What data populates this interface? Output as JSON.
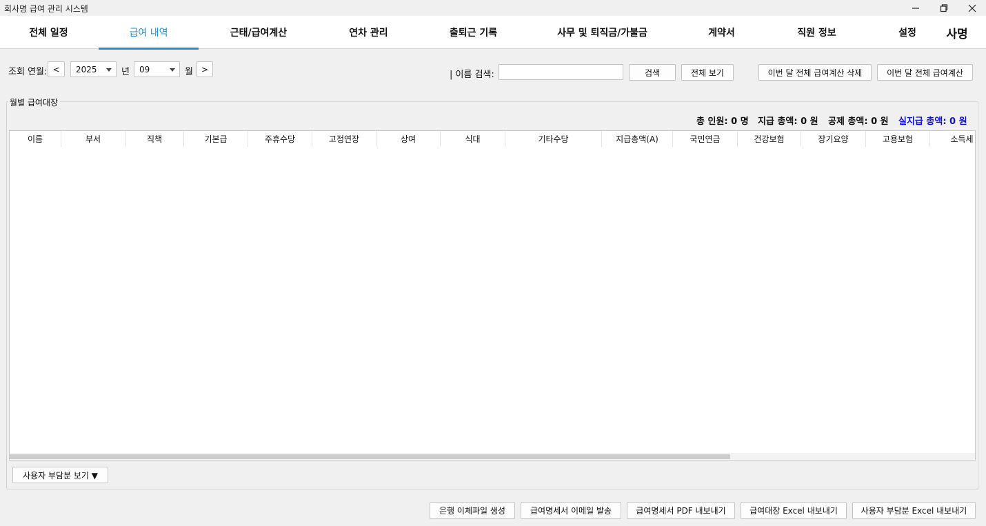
{
  "window": {
    "title": "회사명 급여 관리 시스템",
    "controls": [
      "minimize-icon",
      "restore-icon",
      "close-icon"
    ]
  },
  "tabs": [
    {
      "label": "전체 일정",
      "active": false
    },
    {
      "label": "급여 내역",
      "active": true
    },
    {
      "label": "근태/급여계산",
      "active": false
    },
    {
      "label": "연차 관리",
      "active": false
    },
    {
      "label": "출퇴근 기록",
      "active": false
    },
    {
      "label": "사무 및 퇴직금/가불금",
      "active": false
    },
    {
      "label": "계약서",
      "active": false
    },
    {
      "label": "직원 정보",
      "active": false
    },
    {
      "label": "설정",
      "active": false
    }
  ],
  "company_name": "사명",
  "toolbar": {
    "period_label": "조회 연월:",
    "prev_label": "<",
    "year_value": "2025",
    "year_unit": "년",
    "month_value": "09",
    "month_unit": "월",
    "next_label": ">",
    "search_label": "|  이름 검색:",
    "search_value": "",
    "search_button": "검색",
    "show_all_button": "전체 보기",
    "delete_all_button": "이번 달 전체 급여계산 삭제",
    "calc_all_button": "이번 달 전체 급여계산"
  },
  "ledger": {
    "title": "월별 급여대장",
    "total_staff": "총 인원: 0 명",
    "total_pay": "지급 총액: 0 원",
    "total_deduction": "공제 총액: 0 원",
    "net_pay": "실지급 총액: 0 원",
    "columns": [
      "이름",
      "부서",
      "직책",
      "기본급",
      "주휴수당",
      "고정연장",
      "상여",
      "식대",
      "기타수당",
      "지급총액(A)",
      "국민연금",
      "건강보험",
      "장기요양",
      "고용보험",
      "소득세"
    ],
    "rows": [],
    "employer_toggle": "사용자 부담분 보기 ▼"
  },
  "footer": {
    "bank_file": "은행 이체파일 생성",
    "email_payslip": "급여명세서 이메일 발송",
    "pdf_payslip": "급여명세서 PDF 내보내기",
    "excel_ledger": "급여대장 Excel 내보내기",
    "excel_employer": "사용자 부담분 Excel 내보내기"
  },
  "colors": {
    "accent": "#1a8fd6",
    "net_pay": "#1010d0",
    "background": "#f0f0f0"
  }
}
